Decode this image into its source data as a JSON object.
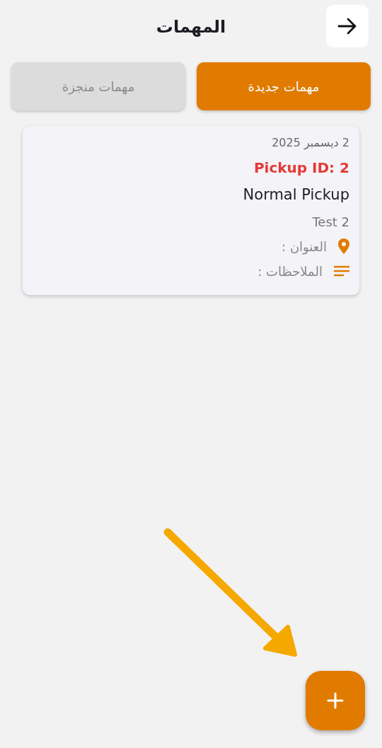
{
  "header": {
    "title": "المهمات"
  },
  "tabs": [
    {
      "label": "مهمات جديدة",
      "selected": true
    },
    {
      "label": "مهمات منجزة",
      "selected": false
    }
  ],
  "tasks": [
    {
      "date": "2 ديسمبر 2025",
      "pickup_id": "Pickup ID: 2",
      "type": "Normal Pickup",
      "name": "Test 2",
      "address_label": "العنوان :",
      "notes_label": "الملاحظات :"
    }
  ]
}
